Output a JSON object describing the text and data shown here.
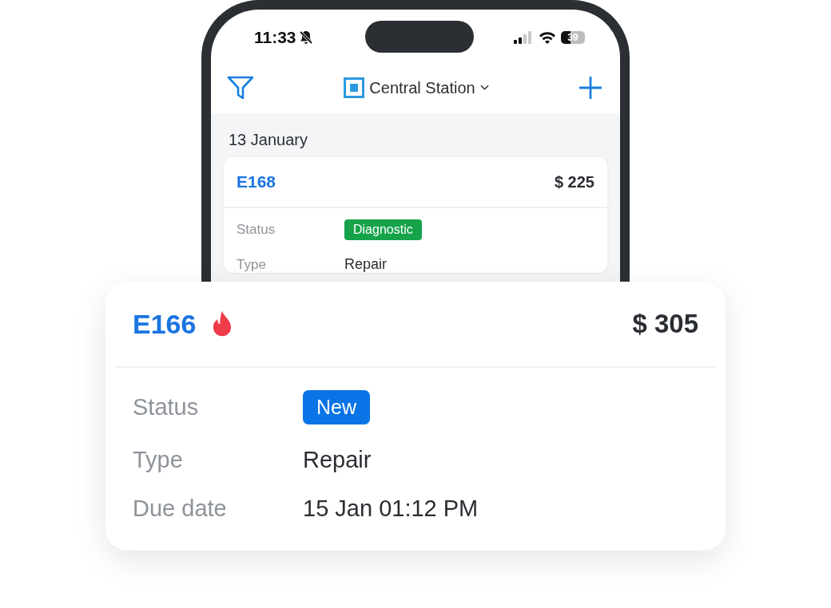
{
  "status_bar": {
    "time": "11:33",
    "silent": true,
    "battery": "39"
  },
  "nav": {
    "location": "Central Station"
  },
  "date_header": "13 January",
  "orders": [
    {
      "number": "E168",
      "hot": false,
      "amount": "$ 225",
      "fields": [
        {
          "label": "Status",
          "value": "Diagnostic",
          "kind": "badge",
          "color": "#16a34a"
        },
        {
          "label": "Type",
          "value": "Repair",
          "kind": "text"
        }
      ]
    },
    {
      "number": "E166",
      "hot": true,
      "amount": "$ 305",
      "fields": [
        {
          "label": "Status",
          "value": "New",
          "kind": "badge",
          "color": "#0a74e6"
        },
        {
          "label": "Type",
          "value": "Repair",
          "kind": "text"
        },
        {
          "label": "Due date",
          "value": "15 Jan 01:12 PM",
          "kind": "text"
        }
      ]
    }
  ]
}
